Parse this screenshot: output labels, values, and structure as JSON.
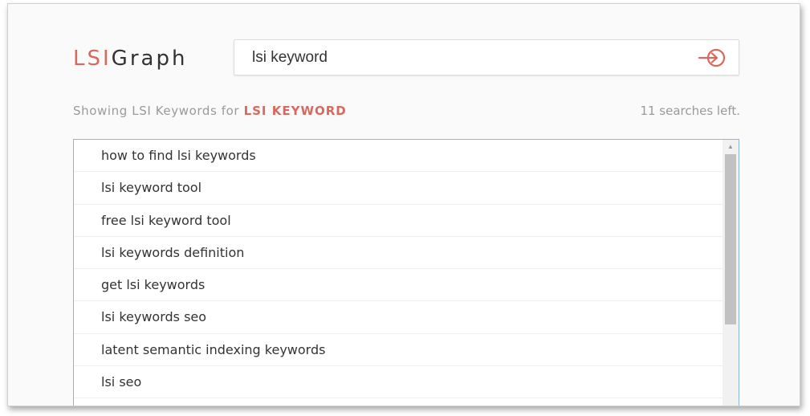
{
  "logo": {
    "part1": "LSI",
    "part2": "Graph"
  },
  "search": {
    "value": "lsi keyword",
    "placeholder": "",
    "submit_icon": "sign-in-arrow-icon"
  },
  "results_header": {
    "prefix": "Showing LSI Keywords for ",
    "keyword": "LSI KEYWORD",
    "searches_left": "11 searches left."
  },
  "results": [
    "how to find lsi keywords",
    "lsi keyword tool",
    "free lsi keyword tool",
    "lsi keywords definition",
    "get lsi keywords",
    "lsi keywords seo",
    "latent semantic indexing keywords",
    "lsi seo"
  ],
  "colors": {
    "accent": "#d9685e",
    "text": "#333333",
    "muted": "#9a9a9a",
    "list_border": "#8fb6d8"
  },
  "scroll_up_icon": "triangle-up-icon"
}
